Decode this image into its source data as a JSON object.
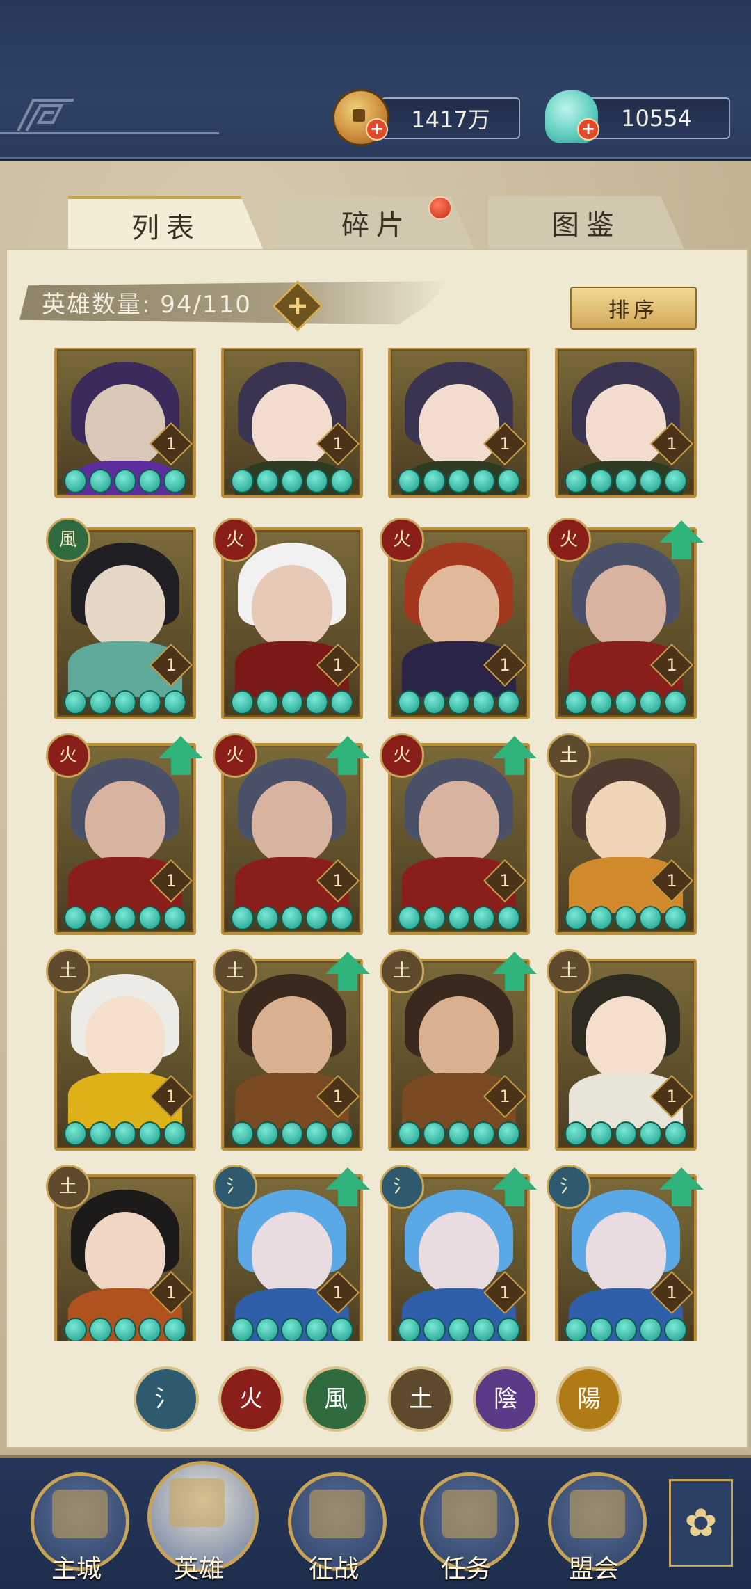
{
  "resources": {
    "coins": {
      "icon": "copper-coin-icon",
      "value": "1417万"
    },
    "shells": {
      "icon": "jade-shell-icon",
      "value": "10554"
    }
  },
  "tabs": [
    {
      "label": "列表",
      "active": true
    },
    {
      "label": "碎片",
      "active": false,
      "badge": true
    },
    {
      "label": "图鉴",
      "active": false
    }
  ],
  "hero_count": {
    "label": "英雄数量:",
    "value": "94/110"
  },
  "sort_label": "排序",
  "elements": {
    "water": "氵",
    "fire": "火",
    "wind": "風",
    "earth": "土",
    "yin": "陰",
    "yang": "陽"
  },
  "element_colors": {
    "water": "#2d5a6e",
    "fire": "#8a1f1a",
    "wind": "#2f6b3e",
    "earth": "#5e4a2c",
    "yin": "#5a3a86",
    "yang": "#b07a14"
  },
  "heroes": [
    {
      "element": "",
      "level": "1",
      "stars": 5,
      "upgrade": false,
      "palette": "purple"
    },
    {
      "element": "",
      "level": "1",
      "stars": 5,
      "upgrade": false,
      "palette": "olive"
    },
    {
      "element": "",
      "level": "1",
      "stars": 5,
      "upgrade": false,
      "palette": "olive"
    },
    {
      "element": "",
      "level": "1",
      "stars": 5,
      "upgrade": false,
      "palette": "olive"
    },
    {
      "element": "wind",
      "level": "1",
      "stars": 5,
      "upgrade": false,
      "palette": "teal"
    },
    {
      "element": "fire",
      "level": "1",
      "stars": 5,
      "upgrade": false,
      "palette": "white"
    },
    {
      "element": "fire",
      "level": "1",
      "stars": 5,
      "upgrade": false,
      "palette": "crimson"
    },
    {
      "element": "fire",
      "level": "1",
      "stars": 5,
      "upgrade": true,
      "palette": "grey"
    },
    {
      "element": "fire",
      "level": "1",
      "stars": 5,
      "upgrade": true,
      "palette": "grey"
    },
    {
      "element": "fire",
      "level": "1",
      "stars": 5,
      "upgrade": true,
      "palette": "grey"
    },
    {
      "element": "fire",
      "level": "1",
      "stars": 5,
      "upgrade": true,
      "palette": "grey"
    },
    {
      "element": "earth",
      "level": "1",
      "stars": 5,
      "upgrade": false,
      "palette": "orange"
    },
    {
      "element": "earth",
      "level": "1",
      "stars": 5,
      "upgrade": false,
      "palette": "yellow"
    },
    {
      "element": "earth",
      "level": "1",
      "stars": 5,
      "upgrade": true,
      "palette": "bronze"
    },
    {
      "element": "earth",
      "level": "1",
      "stars": 5,
      "upgrade": true,
      "palette": "bronze"
    },
    {
      "element": "earth",
      "level": "1",
      "stars": 5,
      "upgrade": false,
      "palette": "cream"
    },
    {
      "element": "earth",
      "level": "1",
      "stars": 5,
      "upgrade": false,
      "palette": "rust"
    },
    {
      "element": "water",
      "level": "1",
      "stars": 5,
      "upgrade": true,
      "palette": "blue"
    },
    {
      "element": "water",
      "level": "1",
      "stars": 5,
      "upgrade": true,
      "palette": "blue"
    },
    {
      "element": "water",
      "level": "1",
      "stars": 5,
      "upgrade": true,
      "palette": "blue"
    }
  ],
  "filters": [
    {
      "key": "water",
      "label": "氵"
    },
    {
      "key": "fire",
      "label": "火"
    },
    {
      "key": "wind",
      "label": "風"
    },
    {
      "key": "earth",
      "label": "土"
    },
    {
      "key": "yin",
      "label": "陰"
    },
    {
      "key": "yang",
      "label": "陽"
    }
  ],
  "nav": [
    {
      "label": "主城",
      "icon": "city-icon",
      "active": false
    },
    {
      "label": "英雄",
      "icon": "hero-icon",
      "active": true
    },
    {
      "label": "征战",
      "icon": "battle-icon",
      "active": false
    },
    {
      "label": "任务",
      "icon": "quest-icon",
      "active": false
    },
    {
      "label": "盟会",
      "icon": "alliance-icon",
      "active": false
    }
  ],
  "menu_icon": "menu-icon"
}
